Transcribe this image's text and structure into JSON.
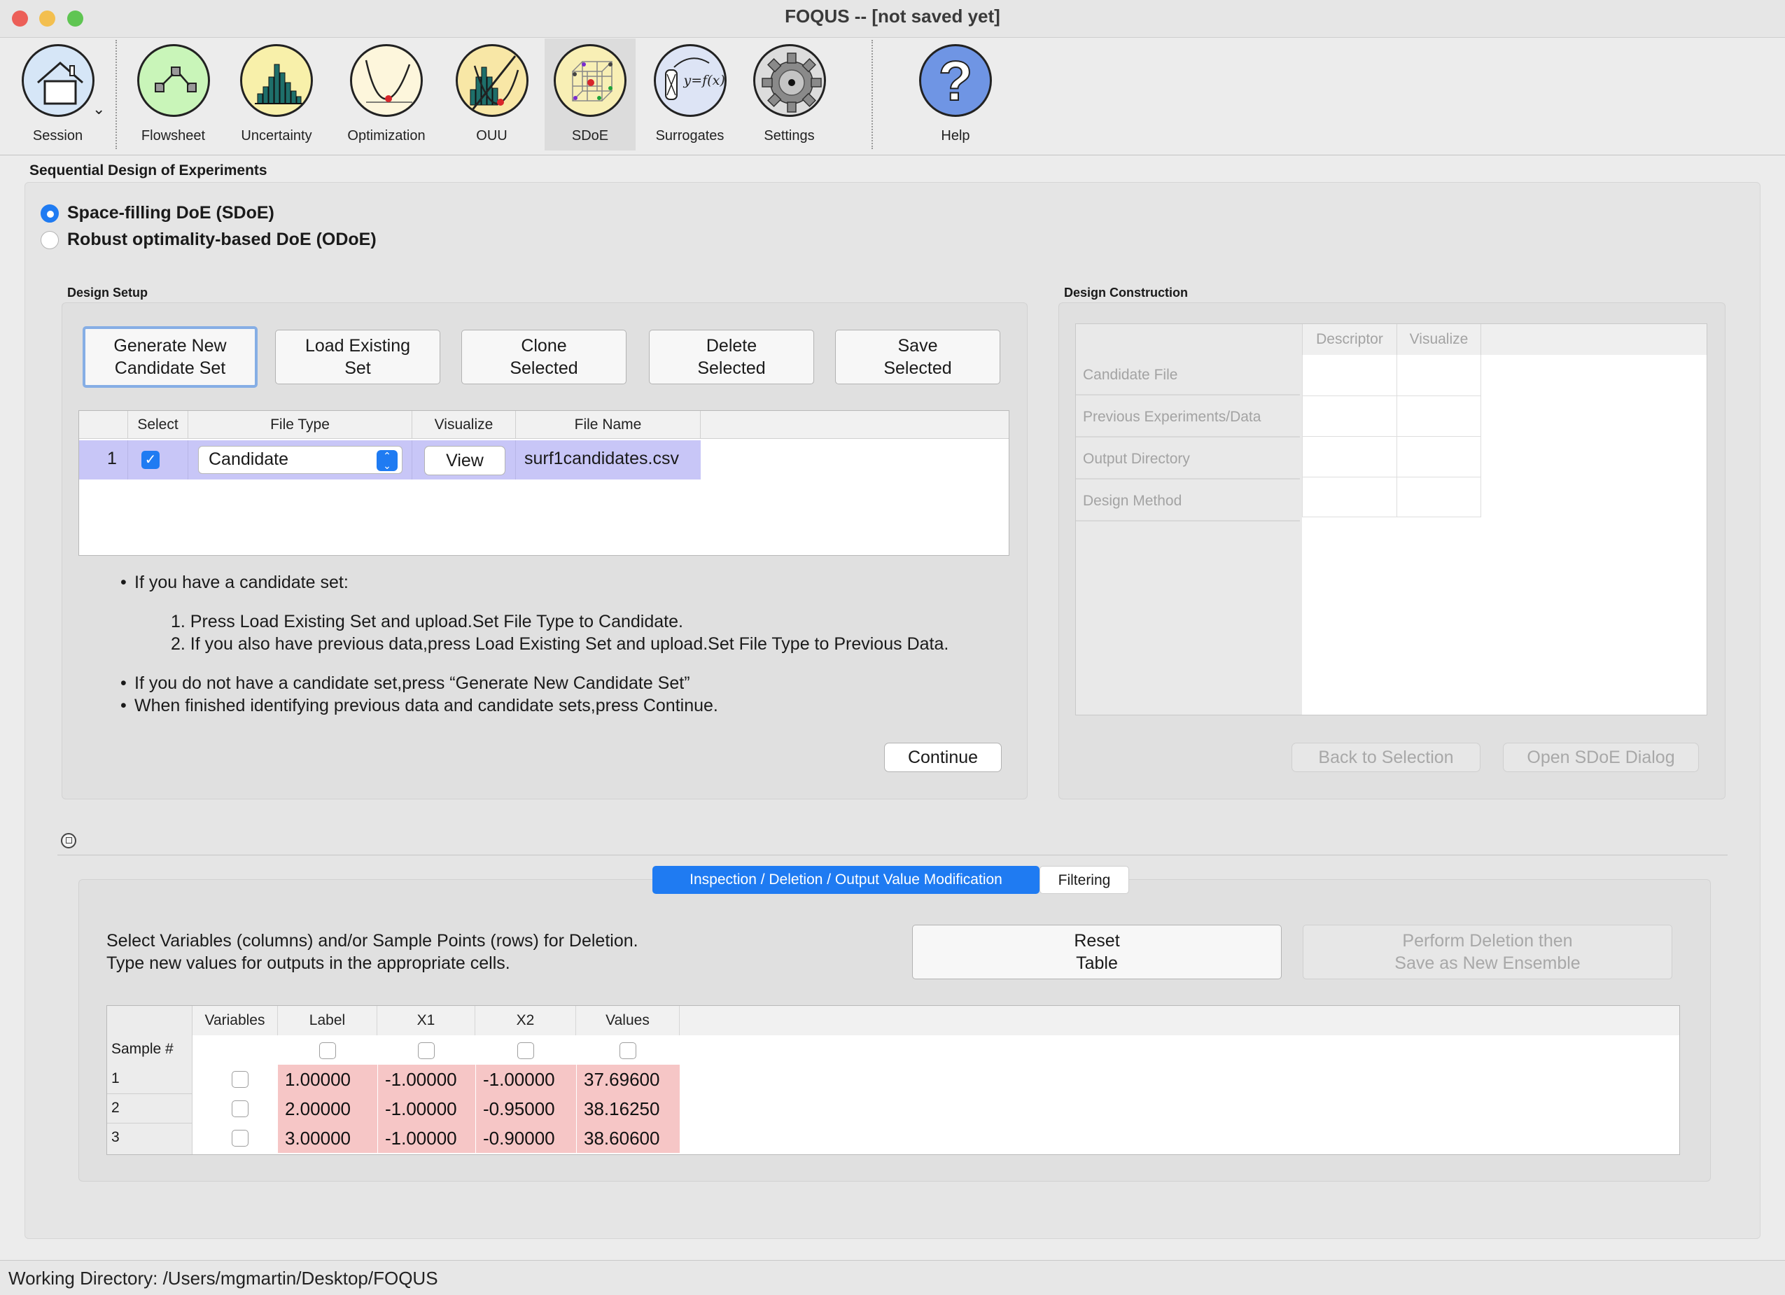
{
  "window": {
    "title": "FOQUS -- [not saved yet]"
  },
  "toolbar": {
    "items": [
      {
        "label": "Session",
        "icon": "house-icon"
      },
      {
        "label": "Flowsheet",
        "icon": "flowsheet-icon"
      },
      {
        "label": "Uncertainty",
        "icon": "histogram-icon"
      },
      {
        "label": "Optimization",
        "icon": "optimization-curve-icon"
      },
      {
        "label": "OUU",
        "icon": "ouu-icon"
      },
      {
        "label": "SDoE",
        "icon": "sdoe-cube-icon"
      },
      {
        "label": "Surrogates",
        "icon": "surrogate-function-icon",
        "icon_text": "y=f(x)"
      },
      {
        "label": "Settings",
        "icon": "gear-icon"
      },
      {
        "label": "Help",
        "icon": "help-icon",
        "icon_text": "?"
      }
    ],
    "active": "SDoE"
  },
  "section_title": "Sequential Design of Experiments",
  "doe_type": {
    "options": [
      "Space-filling DoE (SDoE)",
      "Robust optimality-based DoE (ODoE)"
    ],
    "selected": "Space-filling DoE (SDoE)"
  },
  "design_setup": {
    "title": "Design Setup",
    "buttons": {
      "generate": "Generate New\nCandidate Set",
      "load": "Load Existing\nSet",
      "clone": "Clone\nSelected",
      "delete": "Delete\nSelected",
      "save": "Save\nSelected"
    },
    "table": {
      "headers": [
        "Select",
        "File Type",
        "Visualize",
        "File Name"
      ],
      "rows": [
        {
          "num": "1",
          "selected": true,
          "file_type": "Candidate",
          "visualize": "View",
          "file_name": "surf1candidates.csv"
        }
      ]
    },
    "instructions": {
      "b1": "If you have a candidate set:",
      "s1": "1. Press Load Existing Set and upload.Set File Type to Candidate.",
      "s2": "2. If you also have previous data,press Load Existing Set and upload.Set File Type to Previous Data.",
      "b2": "If you do not have a candidate set,press “Generate New Candidate Set”",
      "b3": "When finished identifying previous data and candidate sets,press Continue."
    },
    "continue_label": "Continue"
  },
  "design_construction": {
    "title": "Design Construction",
    "headers": [
      "Descriptor",
      "Visualize"
    ],
    "rows": [
      "Candidate File",
      "Previous Experiments/Data",
      "Output Directory",
      "Design Method"
    ],
    "back_label": "Back to Selection",
    "open_label": "Open SDoE Dialog"
  },
  "lower": {
    "tabs": [
      "Inspection / Deletion / Output Value Modification",
      "Filtering"
    ],
    "active_tab": "Inspection / Deletion / Output Value Modification",
    "instruction_1": "Select Variables (columns) and/or Sample Points (rows) for Deletion.",
    "instruction_2": "Type new values for outputs in the appropriate cells.",
    "reset_label": "Reset\nTable",
    "perform_label": "Perform Deletion then\nSave as New Ensemble",
    "table": {
      "headers": [
        "Variables",
        "Label",
        "X1",
        "X2",
        "Values"
      ],
      "row_header": "Sample #",
      "rows": [
        {
          "num": "1",
          "label": "1.00000",
          "x1": "-1.00000",
          "x2": "-1.00000",
          "values": "37.69600"
        },
        {
          "num": "2",
          "label": "2.00000",
          "x1": "-1.00000",
          "x2": "-0.95000",
          "values": "38.16250"
        },
        {
          "num": "3",
          "label": "3.00000",
          "x1": "-1.00000",
          "x2": "-0.90000",
          "values": "38.60600"
        }
      ]
    }
  },
  "status": {
    "text": "Working Directory: /Users/mgmartin/Desktop/FOQUS"
  },
  "colors": {
    "accent": "#1f7bf2",
    "row_highlight": "#c8c6f7",
    "pink_cell": "#f6c6c6"
  }
}
